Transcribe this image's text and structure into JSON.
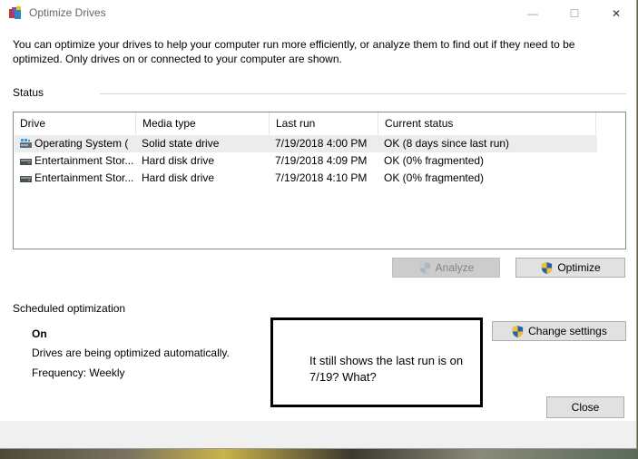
{
  "window": {
    "title": "Optimize Drives",
    "minimize_glyph": "—",
    "maximize_glyph": "☐",
    "close_glyph": "✕",
    "app_icon": "optimize-drives-icon"
  },
  "description": "You can optimize your drives to help your computer run more efficiently, or analyze them to find out if they need to be optimized. Only drives on or connected to your computer are shown.",
  "status": {
    "label": "Status",
    "columns": [
      "Drive",
      "Media type",
      "Last run",
      "Current status"
    ],
    "drives": [
      {
        "name": "Operating System (",
        "media_type": "Solid state drive",
        "last_run": "7/19/2018 4:00 PM",
        "current_status": "OK (8 days since last run)",
        "icon": "os-drive-icon",
        "selected": true
      },
      {
        "name": "Entertainment Stor...",
        "media_type": "Hard disk drive",
        "last_run": "7/19/2018 4:09 PM",
        "current_status": "OK (0% fragmented)",
        "icon": "hard-drive-icon",
        "selected": false
      },
      {
        "name": "Entertainment Stor...",
        "media_type": "Hard disk drive",
        "last_run": "7/19/2018 4:10 PM",
        "current_status": "OK (0% fragmented)",
        "icon": "hard-drive-icon",
        "selected": false
      }
    ]
  },
  "buttons": {
    "analyze": "Analyze",
    "optimize": "Optimize",
    "change_settings": "Change settings",
    "close": "Close"
  },
  "scheduled": {
    "label": "Scheduled optimization",
    "state": "On",
    "auto_text": "Drives are being optimized automatically.",
    "frequency": "Frequency: Weekly"
  },
  "annotation": {
    "text": "It still shows the last run is on 7/19? What?"
  },
  "colors": {
    "shield_blue": "#2a5db0",
    "shield_yellow": "#f2c12e",
    "selected_row": "#ececec"
  }
}
